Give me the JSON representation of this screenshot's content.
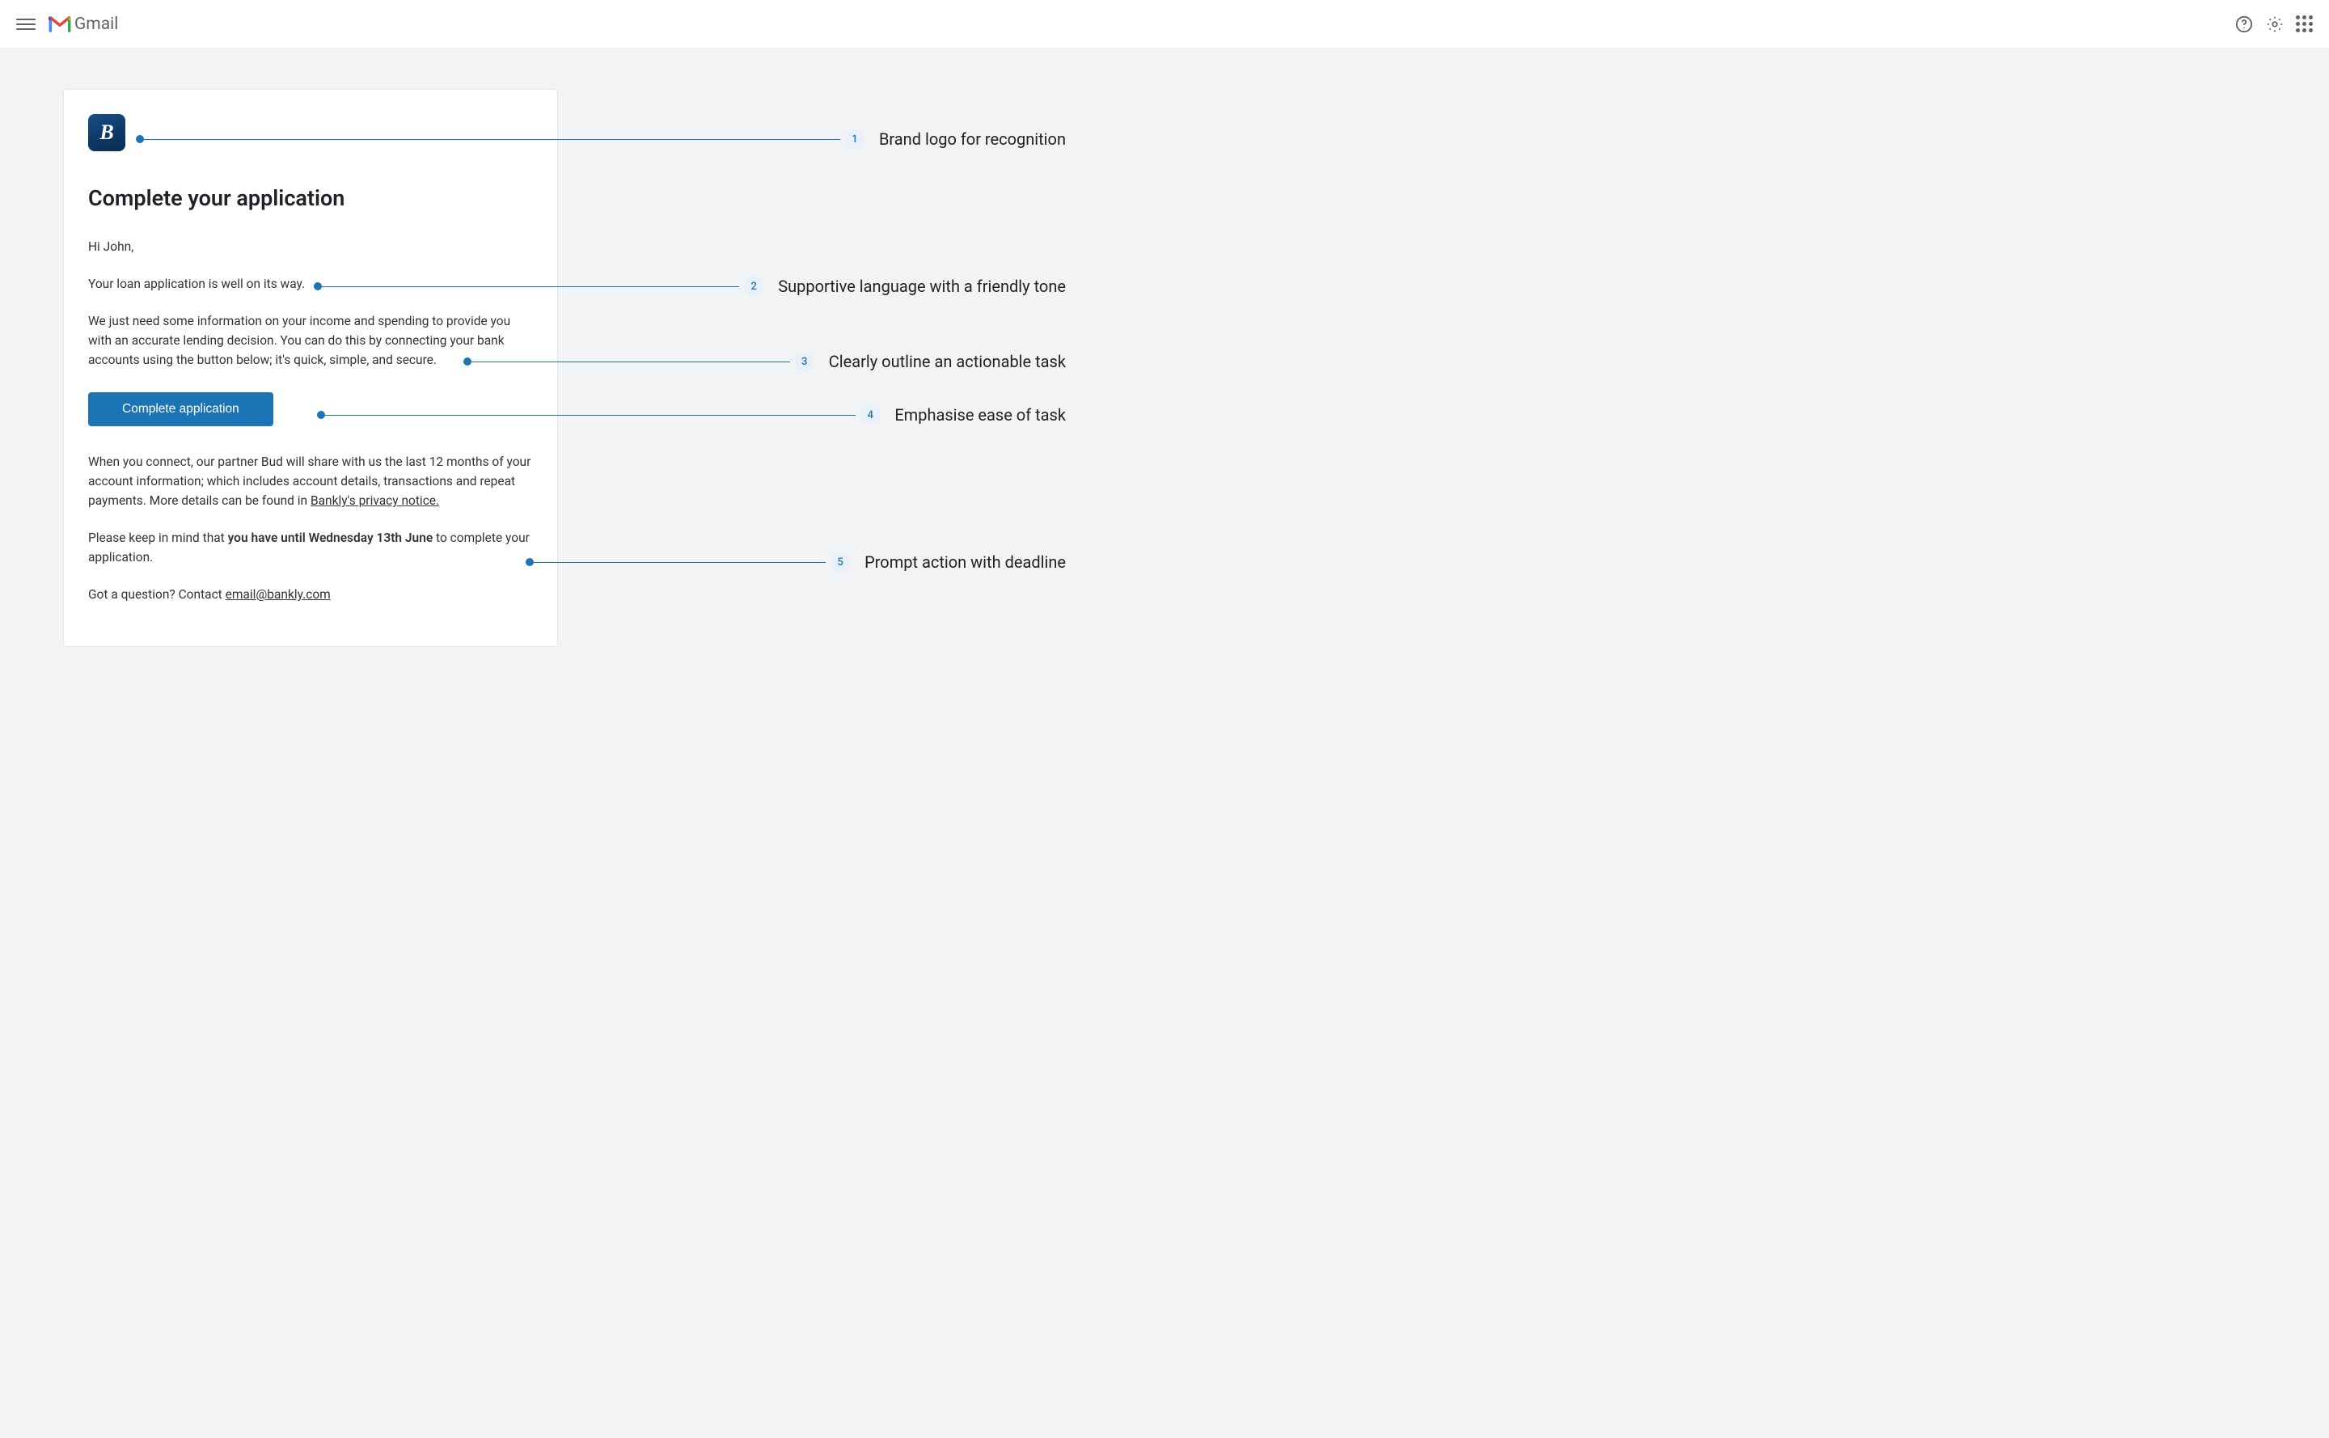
{
  "header": {
    "app_name": "Gmail"
  },
  "email": {
    "title": "Complete your application",
    "greeting": "Hi John,",
    "line1": "Your loan application is well on its way.",
    "line2": "We just need some information on your income and spending to provide you with an accurate lending decision.  You can do this by connecting your bank accounts using the button below; it's quick, simple, and secure.",
    "cta_label": "Complete application",
    "details_pre": "When you connect, our partner Bud will share with us the last 12 months of your account information; which includes account details, transactions and repeat payments. More details can be found in ",
    "privacy_link": "Bankly's privacy notice.",
    "deadline_pre": "Please keep in mind that ",
    "deadline_bold": "you have until Wednesday 13th June",
    "deadline_post": " to complete your application.",
    "contact_pre": "Got a question? Contact ",
    "contact_email": "email@bankly.com"
  },
  "annotations": [
    {
      "num": "1",
      "text": "Brand logo for recognition"
    },
    {
      "num": "2",
      "text": "Supportive language with a friendly tone"
    },
    {
      "num": "3",
      "text": "Clearly outline an actionable task"
    },
    {
      "num": "4",
      "text": "Emphasise ease of task"
    },
    {
      "num": "5",
      "text": "Prompt action with deadline"
    }
  ],
  "colors": {
    "accent": "#1b74b5",
    "badge_bg": "#e8f1fa"
  }
}
